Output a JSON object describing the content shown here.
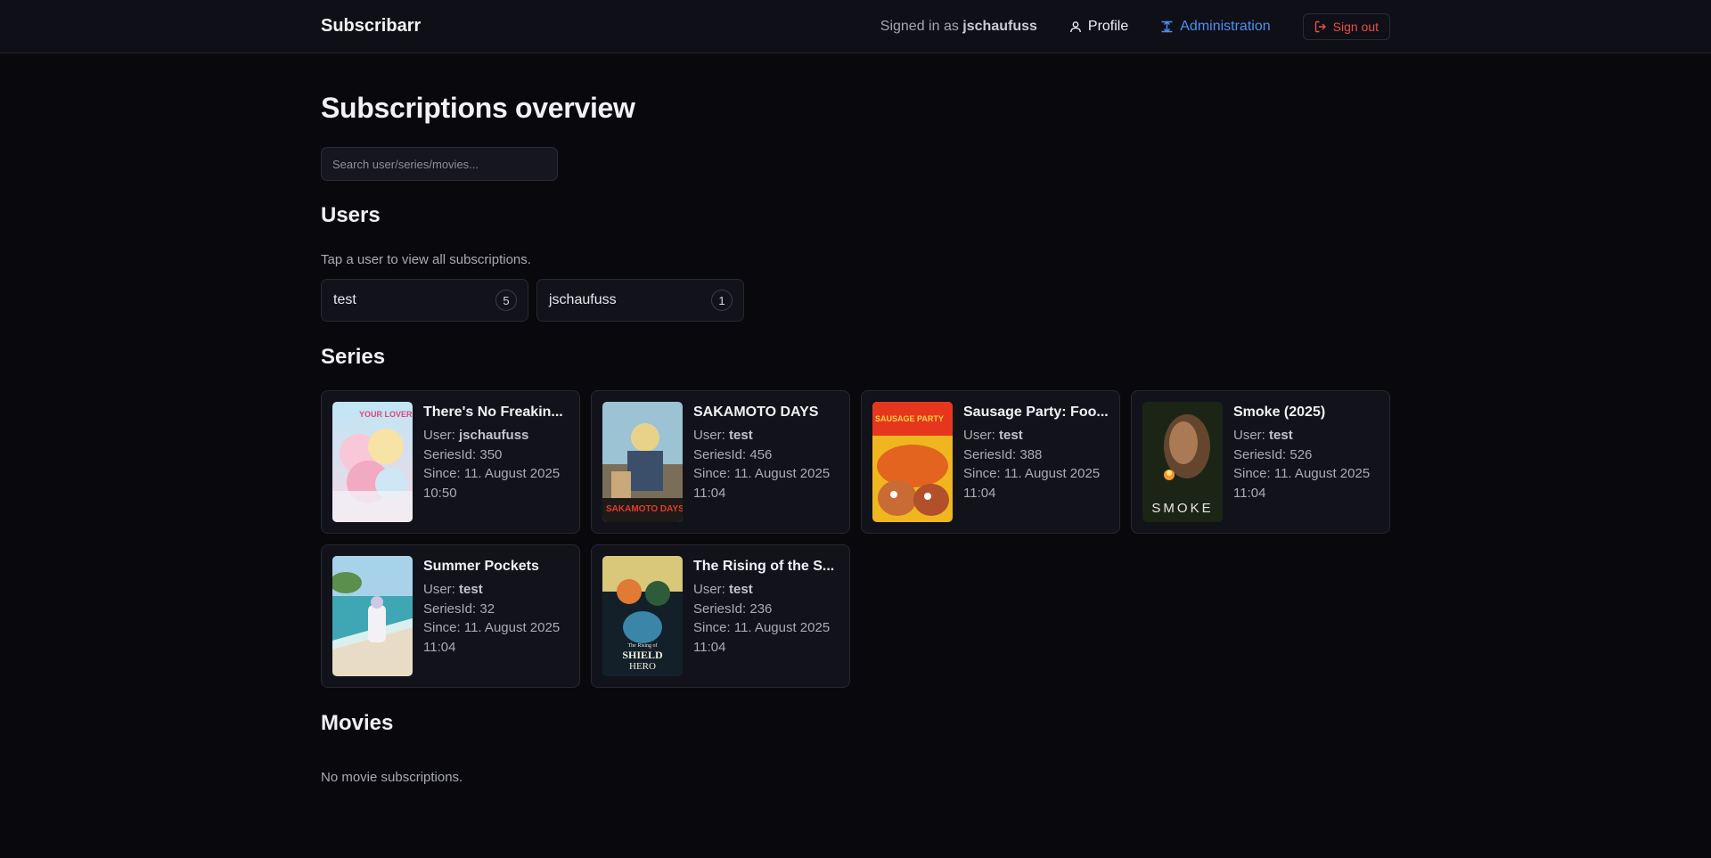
{
  "app": {
    "title": "Subscribarr"
  },
  "nav": {
    "signed_prefix": "Signed in as",
    "username": "jschaufuss",
    "profile_label": "Profile",
    "admin_label": "Administration",
    "signout_label": "Sign out",
    "admin_color": "#4e8ff0",
    "signout_color": "#ef4a4a"
  },
  "page": {
    "heading": "Subscriptions overview",
    "search_placeholder": "Search user/series/movies..."
  },
  "users": {
    "heading": "Users",
    "hint": "Tap a user to view all subscriptions.",
    "items": [
      {
        "name": "test",
        "count": "5"
      },
      {
        "name": "jschaufuss",
        "count": "1"
      }
    ]
  },
  "series": {
    "heading": "Series",
    "user_label": "User:",
    "items": [
      {
        "title": "There's No Freakin...",
        "user": "jschaufuss",
        "series_id": "SeriesId: 350",
        "since": "Since: 11. August 2025",
        "time": "10:50",
        "poster_icon": "anime-poster"
      },
      {
        "title": "SAKAMOTO DAYS",
        "user": "test",
        "series_id": "SeriesId: 456",
        "since": "Since: 11. August 2025",
        "time": "11:04",
        "poster_icon": "anime-poster"
      },
      {
        "title": "Sausage Party: Foo...",
        "user": "test",
        "series_id": "SeriesId: 388",
        "since": "Since: 11. August 2025",
        "time": "11:04",
        "poster_icon": "cartoon-poster"
      },
      {
        "title": "Smoke (2025)",
        "user": "test",
        "series_id": "SeriesId: 526",
        "since": "Since: 11. August 2025",
        "time": "11:04",
        "poster_icon": "drama-poster"
      },
      {
        "title": "Summer Pockets",
        "user": "test",
        "series_id": "SeriesId: 32",
        "since": "Since: 11. August 2025",
        "time": "11:04",
        "poster_icon": "beach-poster"
      },
      {
        "title": "The Rising of the S...",
        "user": "test",
        "series_id": "SeriesId: 236",
        "since": "Since: 11. August 2025",
        "time": "11:04",
        "poster_icon": "anime-poster"
      }
    ],
    "poster_text": {
      "p0": "YOUR LOVER",
      "p1": "SAKAMOTO DAYS",
      "p2": "SAUSAGE PARTY",
      "p3": "SMOKE",
      "p5a": "The Rising of",
      "p5b": "SHIELD",
      "p5c": "HERO"
    }
  },
  "movies": {
    "heading": "Movies",
    "empty_text": "No movie subscriptions."
  }
}
